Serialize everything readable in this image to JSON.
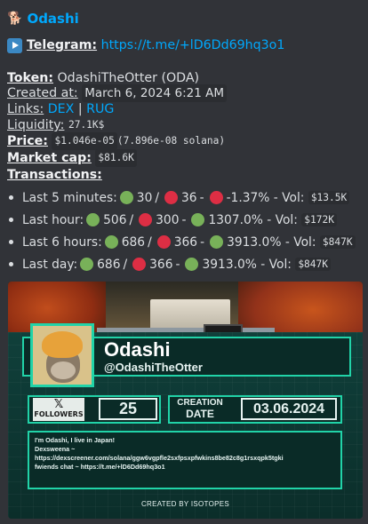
{
  "header": {
    "title": "Odashi",
    "title_icon": "dog-icon"
  },
  "telegram": {
    "label": "Telegram:",
    "url": "https://t.me/+lD6Dd69hq3o1"
  },
  "details": {
    "token_label": "Token:",
    "token_value": "OdashiTheOtter (ODA)",
    "created_label": "Created at:",
    "created_value": "March 6, 2024 6:21 AM",
    "links_label": "Links:",
    "link_dex": "DEX",
    "link_sep": "|",
    "link_rug": "RUG",
    "liquidity_label": "Liquidity:",
    "liquidity_value": "27.1K$",
    "price_label": "Price:",
    "price_value": "$1.046e-05",
    "price_sol": "(7.896e-08 solana)",
    "mcap_label": "Market cap:",
    "mcap_value": "$81.6K",
    "tx_label": "Transactions:"
  },
  "transactions": [
    {
      "period": "Last 5 minutes:",
      "buys": "30",
      "sells": "36",
      "change": "-1.37%",
      "change_dir": "down",
      "vol_label": "- Vol:",
      "vol": "$13.5K"
    },
    {
      "period": "Last hour:",
      "buys": "506",
      "sells": "300",
      "change": "1307.0%",
      "change_dir": "up",
      "vol_label": "- Vol:",
      "vol": "$172K"
    },
    {
      "period": "Last 6 hours:",
      "buys": "686",
      "sells": "366",
      "change": "3913.0%",
      "change_dir": "up",
      "vol_label": "- Vol:",
      "vol": "$847K"
    },
    {
      "period": "Last day:",
      "buys": "686",
      "sells": "366",
      "change": "3913.0%",
      "change_dir": "up",
      "vol_label": "- Vol:",
      "vol": "$847K"
    }
  ],
  "card": {
    "name": "Odashi",
    "handle": "@OdashiTheOtter",
    "followers_label": "FOLLOWERS",
    "followers": "25",
    "creation_line1": "CREATION",
    "creation_line2": "DATE",
    "creation_date": "03.06.2024",
    "desc_line1": "I'm Odashi, I live in Japan!",
    "desc_line2": "Dexsweena ~",
    "desc_line3": "https://dexscreener.com/solana/ggw6vgpfle2sxfpsxpfwkins8be82c8g1rsxqpk5tgki",
    "desc_line4": "fwiends chat ~ https://t.me/+lD6Dd69hq3o1",
    "footer": "CREATED BY ISOTOPES"
  },
  "colors": {
    "link": "#00a8fc",
    "green": "#78b159",
    "red": "#dd2e44",
    "accent": "#21d3a8"
  }
}
